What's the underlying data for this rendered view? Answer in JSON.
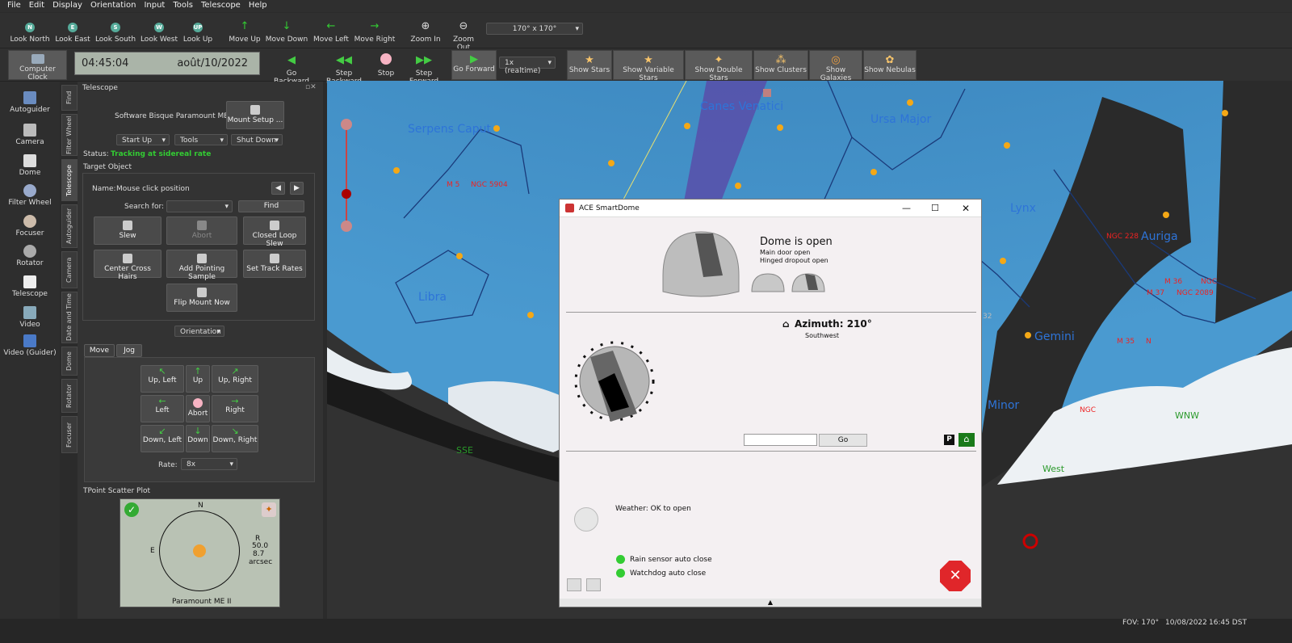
{
  "menu": [
    "File",
    "Edit",
    "Display",
    "Orientation",
    "Input",
    "Tools",
    "Telescope",
    "Help"
  ],
  "toolbar1": {
    "look": [
      "Look North",
      "Look East",
      "Look South",
      "Look West",
      "Look Up"
    ],
    "move": [
      "Move Up",
      "Move Down",
      "Move Left",
      "Move Right"
    ],
    "zoom": [
      "Zoom In",
      "Zoom Out"
    ],
    "fov_select": "170° x 170°"
  },
  "toolbar2": {
    "computer_clock": "Computer Clock",
    "time": "04:45:04",
    "date": "août/10/2022",
    "go_backward": "Go Backward",
    "step_backward": "Step Backward",
    "stop": "Stop",
    "step_forward": "Step Forward",
    "go_forward": "Go Forward",
    "rate": "1x (realtime)",
    "show": [
      "Show Stars",
      "Show Variable Stars",
      "Show Double Stars",
      "Show Clusters",
      "Show Galaxies",
      "Show Nebulas"
    ]
  },
  "left_tools": [
    "Autoguider",
    "Camera",
    "Dome",
    "Filter Wheel",
    "Focuser",
    "Rotator",
    "Telescope",
    "Video",
    "Video (Guider)"
  ],
  "vtabs": [
    "Find",
    "Filter Wheel",
    "Telescope",
    "Autoguider",
    "Camera",
    "Date and Time",
    "Dome",
    "Rotator",
    "Focuser"
  ],
  "telescope": {
    "header": "Telescope",
    "mount": "Software Bisque Paramount ME II",
    "mount_setup": "Mount Setup ...",
    "start_up": "Start Up",
    "tools": "Tools",
    "shut_down": "Shut Down",
    "status_label": "Status:",
    "status_value": "Tracking at sidereal rate",
    "target_object": "Target Object",
    "name_label": "Name:",
    "name_value": "Mouse click position",
    "search_label": "Search for:",
    "find": "Find",
    "buttons": [
      "Slew",
      "Abort",
      "Closed Loop Slew",
      "Center Cross Hairs",
      "Add Pointing Sample",
      "Set Track Rates",
      "Flip Mount Now"
    ],
    "orientation": "Orientation",
    "move_tab": "Move",
    "jog_tab": "Jog",
    "move_buttons": [
      "Up, Left",
      "Up",
      "Up, Right",
      "Left",
      "Abort",
      "Right",
      "Down, Left",
      "Down",
      "Down, Right"
    ],
    "rate_label": "Rate:",
    "rate_value": "8x",
    "tpoint_title": "TPoint Scatter Plot",
    "tpoint": {
      "n": "N",
      "e": "E",
      "r": "R",
      "v1": "50.0",
      "v2": "8.7",
      "unit": "arcsec",
      "footer": "Paramount ME II"
    }
  },
  "sky": {
    "labels": [
      "Serpens Caput",
      "Canes Venatici",
      "Ursa Major",
      "Lynx",
      "Auriga",
      "Libra",
      "Gemini",
      "Minor"
    ],
    "red": [
      "M 5",
      "NGC 5904",
      "NGC 228",
      "M 36",
      "NGC",
      "M 37",
      "NGC 2089",
      "M 35",
      "N",
      "NGC"
    ],
    "green": [
      "SSE",
      "West",
      "WNW"
    ],
    "gray": [
      "32"
    ]
  },
  "dialog": {
    "title": "ACE SmartDome",
    "dome_status": "Dome is open",
    "main_door": "Main door open",
    "hinged": "Hinged dropout open",
    "azimuth": "Azimuth: 210°",
    "direction": "Southwest",
    "go": "Go",
    "p": "P",
    "weather": "Weather: OK to open",
    "rain": "Rain sensor auto close",
    "watchdog": "Watchdog auto close"
  },
  "status": {
    "fov": "FOV: 170°",
    "date": "10/08/2022",
    "time": "16:45 DST"
  }
}
